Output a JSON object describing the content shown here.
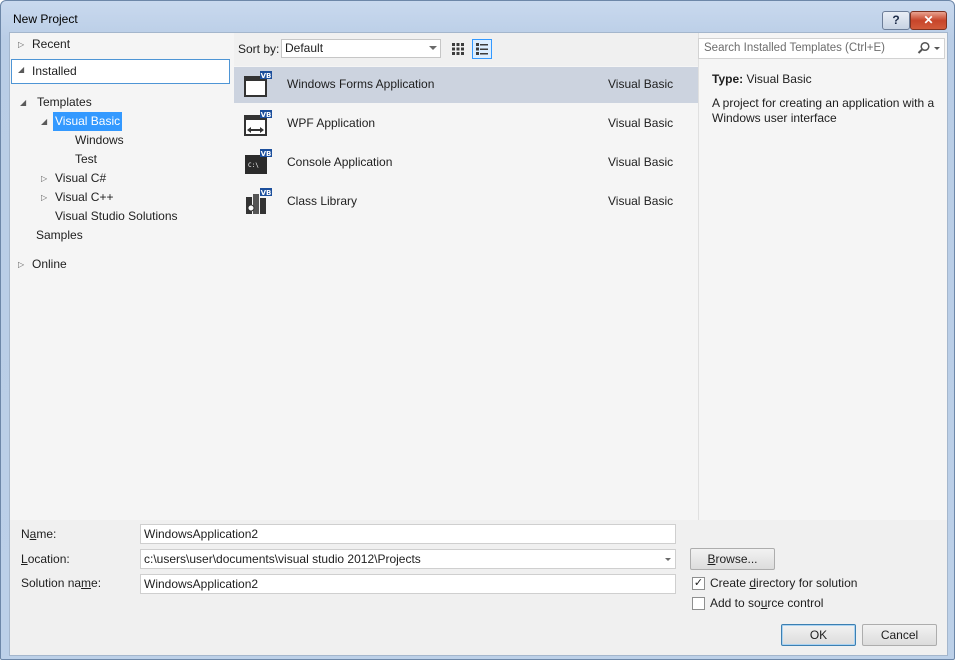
{
  "window": {
    "title": "New Project",
    "help_glyph": "?",
    "close_glyph": "✕"
  },
  "nav": {
    "recent": "Recent",
    "installed": "Installed",
    "templates": "Templates",
    "visual_basic": "Visual Basic",
    "windows": "Windows",
    "test": "Test",
    "visual_csharp": "Visual C#",
    "visual_cpp": "Visual C++",
    "vs_solutions": "Visual Studio Solutions",
    "samples": "Samples",
    "online": "Online"
  },
  "sort": {
    "label": "Sort by:",
    "value": "Default"
  },
  "templates": [
    {
      "name": "Windows Forms Application",
      "language": "Visual Basic",
      "icon": "windows-forms-icon"
    },
    {
      "name": "WPF Application",
      "language": "Visual Basic",
      "icon": "wpf-icon"
    },
    {
      "name": "Console Application",
      "language": "Visual Basic",
      "icon": "console-icon"
    },
    {
      "name": "Class Library",
      "language": "Visual Basic",
      "icon": "class-library-icon"
    }
  ],
  "search": {
    "placeholder": "Search Installed Templates (Ctrl+E)"
  },
  "description": {
    "type_label": "Type:",
    "type_value": "Visual Basic",
    "text": "A project for creating an application with a Windows user interface"
  },
  "form": {
    "name_label_pre": "N",
    "name_label_u": "a",
    "name_label_post": "me:",
    "name_value": "WindowsApplication2",
    "location_label_pre": "",
    "location_label_u": "L",
    "location_label_post": "ocation:",
    "location_value": "c:\\users\\user\\documents\\visual studio 2012\\Projects",
    "solution_label_pre": "Solution na",
    "solution_label_u": "m",
    "solution_label_post": "e:",
    "solution_value": "WindowsApplication2",
    "browse_pre": "",
    "browse_u": "B",
    "browse_post": "rowse...",
    "create_dir_pre": "Create ",
    "create_dir_u": "d",
    "create_dir_post": "irectory for solution",
    "create_dir_checked": true,
    "source_ctrl_pre": "Add to so",
    "source_ctrl_u": "u",
    "source_ctrl_post": "rce control",
    "source_ctrl_checked": false,
    "ok": "OK",
    "cancel": "Cancel",
    "check_glyph": "✓"
  }
}
